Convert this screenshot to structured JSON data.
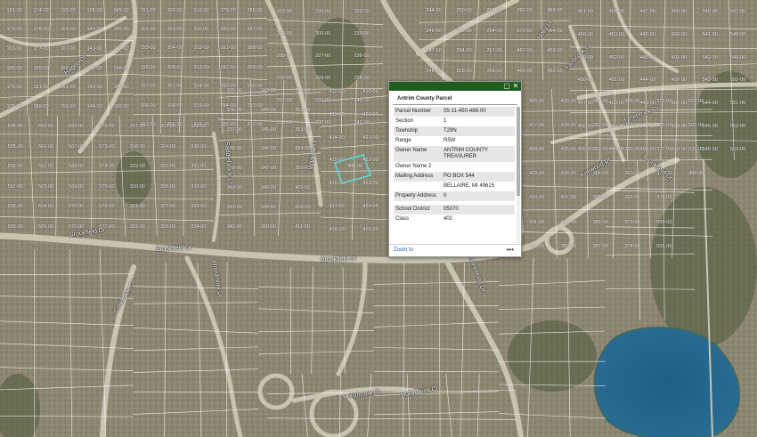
{
  "map": {
    "parcel_labels": [
      "182-00",
      "179-00",
      "163-00",
      "180-00",
      "176-00",
      "175-00",
      "174-00",
      "178-00",
      "177-00",
      "185-00",
      "181-00",
      "189-00",
      "190-00",
      "160-00",
      "167-00",
      "164-00",
      "161-00",
      "159-00",
      "158-00",
      "140-00",
      "141-00",
      "142-00",
      "143-00",
      "144-00",
      "145-00",
      "146-00",
      "147-00",
      "148-00",
      "149-00",
      "150-00",
      "151-00",
      "152-00",
      "155-00",
      "156-00",
      "157-00",
      "306-00",
      "301-00",
      "302-00",
      "303-00",
      "304-00",
      "305-00",
      "307-00",
      "308-00",
      "309-00",
      "310-00",
      "311-00",
      "312-00",
      "313-00",
      "314-00",
      "315-00",
      "316-00",
      "279-00",
      "280-00",
      "281-00",
      "282-00",
      "283-00",
      "284-00",
      "285-00",
      "286-00",
      "287-00",
      "288-00",
      "289-00",
      "290-00",
      "291-00",
      "292-00",
      "293-00",
      "294-00",
      "295-00",
      "296-00",
      "297-00",
      "298-00",
      "299-00",
      "300-00",
      "227-00",
      "228-00",
      "229-00",
      "230-00",
      "232-00",
      "233-00",
      "236-00",
      "238-00",
      "240-00",
      "242-00",
      "244-00",
      "246-00",
      "247-00",
      "248-00",
      "250-00",
      "252-00",
      "254-00",
      "256-00",
      "258-00",
      "264-00",
      "267-00",
      "268-00",
      "269-00",
      "270-00",
      "467-00",
      "466-00",
      "465-00",
      "464-00",
      "463-00",
      "462-00",
      "461-00",
      "460-00",
      "459-00",
      "458-00",
      "457-00",
      "456-00",
      "455-00",
      "454-00",
      "453-00",
      "452-00",
      "451-00",
      "450-00",
      "449-00",
      "448-00",
      "447-00",
      "446-00",
      "445-00",
      "444-00",
      "443-00",
      "442-00",
      "488-00",
      "489-00",
      "490-00",
      "491-00",
      "496-00",
      "497-00",
      "498-00",
      "499-00",
      "540-00",
      "541-00",
      "542-00",
      "543-00",
      "544-00",
      "545-00",
      "546-00",
      "547-00",
      "548-00",
      "549-00",
      "550-00",
      "551-00",
      "552-00",
      "553-00",
      "554-00",
      "555-00",
      "556-00",
      "557-00",
      "558-00",
      "559-00",
      "560-00",
      "561-00",
      "562-00",
      "563-00",
      "564-00",
      "565-00",
      "566-00",
      "567-00",
      "568-00",
      "569-00",
      "570-00",
      "571-00",
      "572-00",
      "573-00",
      "574-00",
      "575-00",
      "576-00",
      "577-00",
      "317-00",
      "318-00",
      "319-00",
      "320-00",
      "321-00",
      "322-00",
      "323-00",
      "324-00",
      "325-00",
      "326-00",
      "327-00",
      "328-00",
      "329-00",
      "330-00",
      "331-00",
      "332-00",
      "333-00",
      "334-00",
      "335-00",
      "336-00",
      "337-00",
      "338-00",
      "339-00",
      "340-00",
      "341-00",
      "342-00",
      "343-00",
      "344-00",
      "345-00",
      "346-00",
      "347-00",
      "348-00",
      "349-00",
      "350-00",
      "351-00",
      "352-00",
      "353-00",
      "354-00",
      "355-00",
      "409-00",
      "410-00",
      "411-00",
      "412-00",
      "413-00",
      "414-00",
      "415-00",
      "416-00",
      "417-00",
      "418-00",
      "419-00",
      "420-00",
      "421-00",
      "422-00",
      "423-00",
      "424-00",
      "425-00",
      "426-00",
      "427-00",
      "428-00",
      "429-00",
      "430-00",
      "431-00",
      "432-00",
      "433-00",
      "434-00",
      "435-00",
      "436-00",
      "437-00",
      "438-00",
      "380-00",
      "381-00",
      "382-00",
      "383-00",
      "384-00",
      "385-00",
      "386-00",
      "387-00",
      "388-00",
      "389-00",
      "390-00",
      "391-00",
      "392-00",
      "373-00",
      "374-00",
      "375-00",
      "376-00",
      "377-00",
      "378-00",
      "379-00",
      "500-00",
      "501-00",
      "502-00",
      "503-00",
      "636-00",
      "498-00"
    ],
    "road_labels": [
      "Brookfield Dr",
      "Brookfield Dr",
      "Brookfield Dr",
      "Hollybrook Ct",
      "Hollybrook Ct",
      "Kirkwood Dr",
      "Wildoak Dr",
      "Saddlebrook Dr",
      "Hagen Dr",
      "Creekside Ct",
      "Holly Dr",
      "Fairbrook Ct",
      "Pinebrook Dr",
      "Brookfield Dr",
      "Lakewood Dr",
      "Woodmont Dr"
    ],
    "highlight_parcel": "488-00"
  },
  "popup": {
    "title": "Antrim County Parcel",
    "maximize_icon": "maximize-icon",
    "close_icon": "close-icon",
    "rows": [
      {
        "key": "Parcel Number",
        "value": "05-11-450-488-00"
      },
      {
        "key": "Section",
        "value": "1"
      },
      {
        "key": "Township",
        "value": "T29N"
      },
      {
        "key": "Range",
        "value": "R5W"
      },
      {
        "key": "Owner Name",
        "value": "ANTRIM COUNTY TREASURER"
      },
      {
        "key": "Owner Name 2",
        "value": ""
      },
      {
        "key": "Mailing Address",
        "value": "PO BOX 544"
      },
      {
        "key": "",
        "value": "BELLAIRE, MI 49615"
      },
      {
        "key": "Property Address",
        "value": "0"
      },
      {
        "key": "",
        "value": ""
      },
      {
        "key": "School District",
        "value": "05070"
      },
      {
        "key": "Class",
        "value": "402"
      }
    ],
    "zoom_label": "Zoom to",
    "more_label": "•••"
  },
  "colors": {
    "titlebar": "#1f5c1f",
    "highlight": "#5ee0e0",
    "parcel_line": "#ffffff"
  }
}
